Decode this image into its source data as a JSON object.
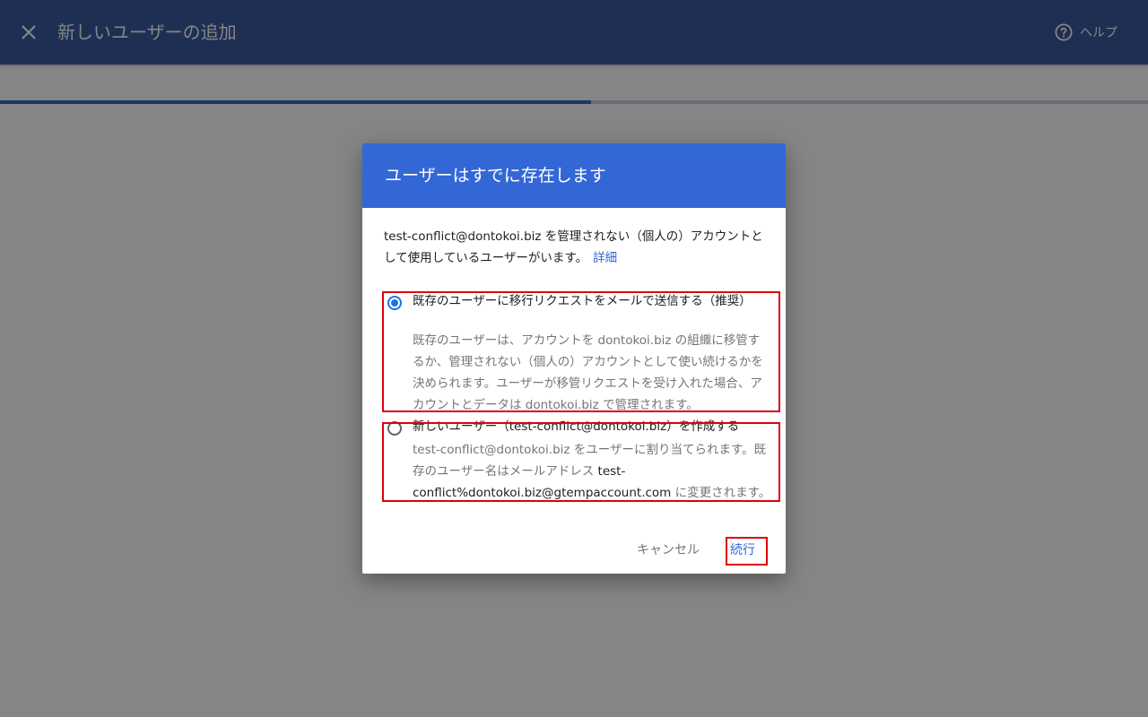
{
  "page": {
    "title": "新しいユーザーの追加",
    "help_label": "ヘルプ",
    "progress_fraction": 0.515
  },
  "dialog": {
    "title": "ユーザーはすでに存在します",
    "description": "test-conflict@dontokoi.biz を管理されない（個人の）アカウントとして使用しているユーザーがいます。",
    "details_link": "詳細",
    "options": [
      {
        "title": "既存のユーザーに移行リクエストをメールで送信する（推奨）",
        "description": "既存のユーザーは、アカウントを dontokoi.biz の組織に移管するか、管理されない（個人の）アカウントとして使い続けるかを決められます。ユーザーが移管リクエストを受け入れた場合、アカウントとデータは dontokoi.biz で管理されます。",
        "selected": true
      },
      {
        "title": "新しいユーザー（test-conflict@dontokoi.biz）を作成する",
        "description_prefix": "test-conflict@dontokoi.biz をユーザーに割り当てられます。既存のユーザー名はメールアドレス",
        "description_value": "test-conflict%dontokoi.biz@gtempaccount.com",
        "description_suffix": "に変更されます。",
        "selected": false
      }
    ],
    "cancel_label": "キャンセル",
    "continue_label": "続行"
  },
  "colors": {
    "header": "#3a5a9f",
    "dialog_header": "#3367d6",
    "accent": "#1a73e8",
    "link": "#3367d6",
    "highlight": "#e0000c"
  },
  "icons": {
    "close": "close-icon",
    "help": "help-circle-icon"
  }
}
